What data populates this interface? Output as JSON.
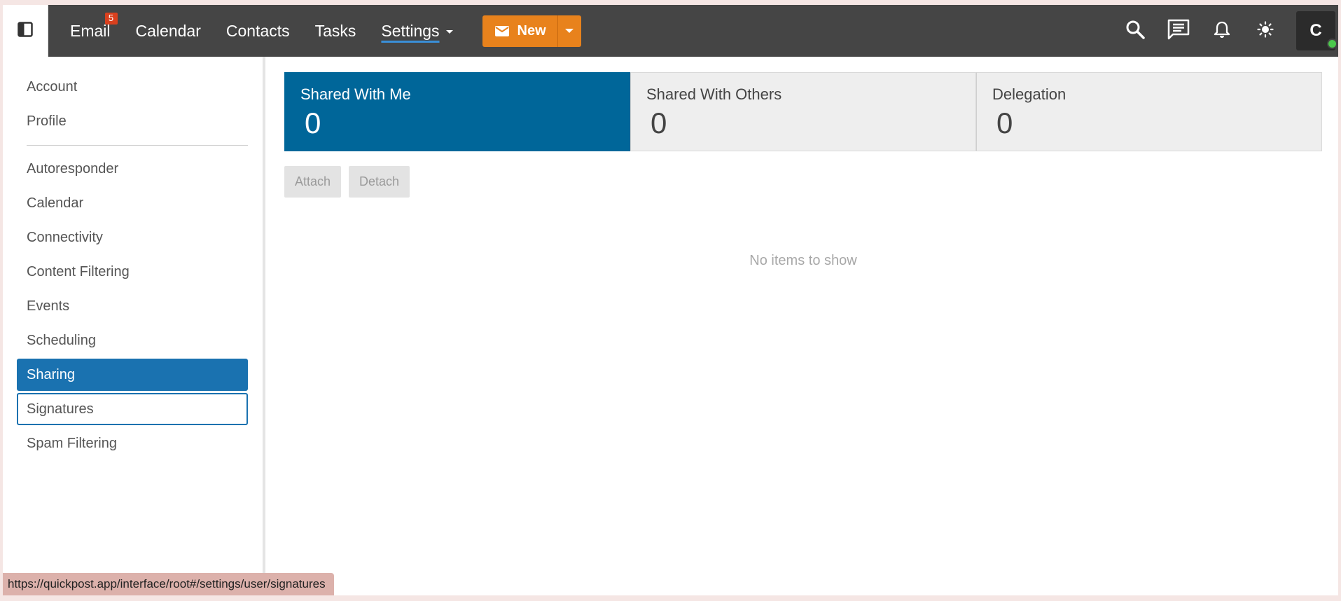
{
  "topbar": {
    "nav": [
      {
        "label": "Email",
        "badge": "5"
      },
      {
        "label": "Calendar"
      },
      {
        "label": "Contacts"
      },
      {
        "label": "Tasks"
      },
      {
        "label": "Settings",
        "active": true
      }
    ],
    "new_button": "New",
    "avatar_initial": "C",
    "icons": [
      "sidebar-toggle-icon",
      "search-icon",
      "chat-icon",
      "bell-icon",
      "sun-icon"
    ]
  },
  "sidebar": {
    "top_items": [
      "Account",
      "Profile"
    ],
    "items": [
      "Autoresponder",
      "Calendar",
      "Connectivity",
      "Content Filtering",
      "Events",
      "Scheduling",
      "Sharing",
      "Signatures",
      "Spam Filtering"
    ],
    "selected": "Sharing",
    "focused": "Signatures"
  },
  "main": {
    "cards": [
      {
        "title": "Shared With Me",
        "count": "0",
        "active": true
      },
      {
        "title": "Shared With Others",
        "count": "0"
      },
      {
        "title": "Delegation",
        "count": "0"
      }
    ],
    "actions": {
      "attach": "Attach",
      "detach": "Detach"
    },
    "empty_text": "No items to show"
  },
  "status_url": "https://quickpost.app/interface/root#/settings/user/signatures",
  "colors": {
    "topbar": "#454545",
    "accent_blue": "#006699",
    "selected_blue": "#1a72b0",
    "new_orange": "#e8821c",
    "badge_red": "#d9401e"
  }
}
